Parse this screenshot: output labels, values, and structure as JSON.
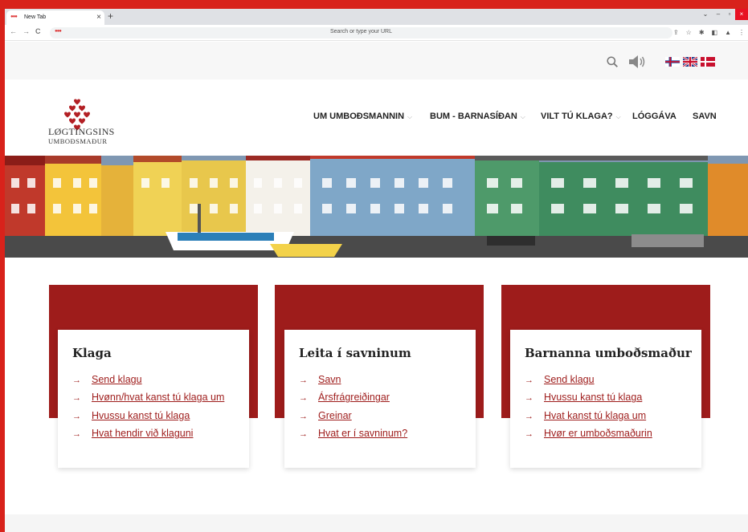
{
  "browser": {
    "tab_title": "New Tab",
    "address_placeholder": "Search or type your URL"
  },
  "site": {
    "logo": {
      "line1": "LØGTINGSINS",
      "line2": "UMBOÐSMAÐUR",
      "color": "#b31f24"
    },
    "utility": {
      "icons": [
        "search-icon",
        "speaker-icon"
      ],
      "languages": [
        "faroese-flag",
        "english-flag",
        "danish-flag"
      ]
    },
    "nav": [
      {
        "label": "UM UMBOÐSMANNIN",
        "dropdown": true
      },
      {
        "label": "BUM - BARNASÍÐAN",
        "dropdown": true
      },
      {
        "label": "VILT TÚ KLAGA?",
        "dropdown": true
      },
      {
        "label": "LÓGGÁVA",
        "dropdown": false
      },
      {
        "label": "SAVN",
        "dropdown": false
      }
    ],
    "accent_color": "#9e1c1b"
  },
  "cards": [
    {
      "title": "Klaga",
      "links": [
        "Send klagu",
        "Hvønn/hvat kanst tú klaga um",
        "Hvussu kanst tú klaga",
        "Hvat hendir við klaguni"
      ]
    },
    {
      "title": "Leita í savninum",
      "links": [
        "Savn",
        "Ársfrágreiðingar",
        "Greinar",
        "Hvat er í savninum?"
      ]
    },
    {
      "title": "Barnanna umboðsmaður",
      "links": [
        "Send klagu",
        "Hvussu kanst tú klaga",
        "Hvat kanst tú klaga um",
        "Hvør er umboðsmaðurin"
      ]
    }
  ]
}
